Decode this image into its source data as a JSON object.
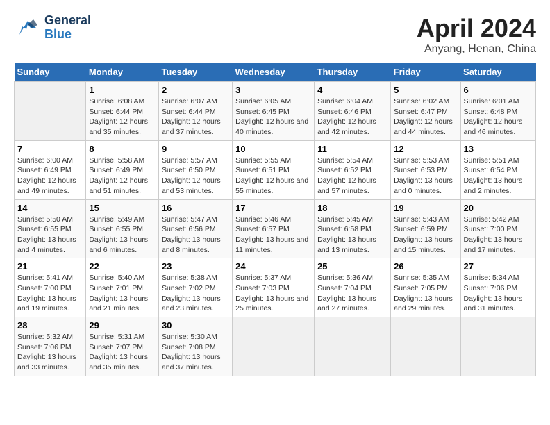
{
  "header": {
    "logo_general": "General",
    "logo_blue": "Blue",
    "title": "April 2024",
    "subtitle": "Anyang, Henan, China"
  },
  "days_of_week": [
    "Sunday",
    "Monday",
    "Tuesday",
    "Wednesday",
    "Thursday",
    "Friday",
    "Saturday"
  ],
  "weeks": [
    [
      {
        "day": "",
        "empty": true
      },
      {
        "day": "1",
        "sunrise": "Sunrise: 6:08 AM",
        "sunset": "Sunset: 6:44 PM",
        "daylight": "Daylight: 12 hours and 35 minutes."
      },
      {
        "day": "2",
        "sunrise": "Sunrise: 6:07 AM",
        "sunset": "Sunset: 6:44 PM",
        "daylight": "Daylight: 12 hours and 37 minutes."
      },
      {
        "day": "3",
        "sunrise": "Sunrise: 6:05 AM",
        "sunset": "Sunset: 6:45 PM",
        "daylight": "Daylight: 12 hours and 40 minutes."
      },
      {
        "day": "4",
        "sunrise": "Sunrise: 6:04 AM",
        "sunset": "Sunset: 6:46 PM",
        "daylight": "Daylight: 12 hours and 42 minutes."
      },
      {
        "day": "5",
        "sunrise": "Sunrise: 6:02 AM",
        "sunset": "Sunset: 6:47 PM",
        "daylight": "Daylight: 12 hours and 44 minutes."
      },
      {
        "day": "6",
        "sunrise": "Sunrise: 6:01 AM",
        "sunset": "Sunset: 6:48 PM",
        "daylight": "Daylight: 12 hours and 46 minutes."
      }
    ],
    [
      {
        "day": "7",
        "sunrise": "Sunrise: 6:00 AM",
        "sunset": "Sunset: 6:49 PM",
        "daylight": "Daylight: 12 hours and 49 minutes."
      },
      {
        "day": "8",
        "sunrise": "Sunrise: 5:58 AM",
        "sunset": "Sunset: 6:49 PM",
        "daylight": "Daylight: 12 hours and 51 minutes."
      },
      {
        "day": "9",
        "sunrise": "Sunrise: 5:57 AM",
        "sunset": "Sunset: 6:50 PM",
        "daylight": "Daylight: 12 hours and 53 minutes."
      },
      {
        "day": "10",
        "sunrise": "Sunrise: 5:55 AM",
        "sunset": "Sunset: 6:51 PM",
        "daylight": "Daylight: 12 hours and 55 minutes."
      },
      {
        "day": "11",
        "sunrise": "Sunrise: 5:54 AM",
        "sunset": "Sunset: 6:52 PM",
        "daylight": "Daylight: 12 hours and 57 minutes."
      },
      {
        "day": "12",
        "sunrise": "Sunrise: 5:53 AM",
        "sunset": "Sunset: 6:53 PM",
        "daylight": "Daylight: 13 hours and 0 minutes."
      },
      {
        "day": "13",
        "sunrise": "Sunrise: 5:51 AM",
        "sunset": "Sunset: 6:54 PM",
        "daylight": "Daylight: 13 hours and 2 minutes."
      }
    ],
    [
      {
        "day": "14",
        "sunrise": "Sunrise: 5:50 AM",
        "sunset": "Sunset: 6:55 PM",
        "daylight": "Daylight: 13 hours and 4 minutes."
      },
      {
        "day": "15",
        "sunrise": "Sunrise: 5:49 AM",
        "sunset": "Sunset: 6:55 PM",
        "daylight": "Daylight: 13 hours and 6 minutes."
      },
      {
        "day": "16",
        "sunrise": "Sunrise: 5:47 AM",
        "sunset": "Sunset: 6:56 PM",
        "daylight": "Daylight: 13 hours and 8 minutes."
      },
      {
        "day": "17",
        "sunrise": "Sunrise: 5:46 AM",
        "sunset": "Sunset: 6:57 PM",
        "daylight": "Daylight: 13 hours and 11 minutes."
      },
      {
        "day": "18",
        "sunrise": "Sunrise: 5:45 AM",
        "sunset": "Sunset: 6:58 PM",
        "daylight": "Daylight: 13 hours and 13 minutes."
      },
      {
        "day": "19",
        "sunrise": "Sunrise: 5:43 AM",
        "sunset": "Sunset: 6:59 PM",
        "daylight": "Daylight: 13 hours and 15 minutes."
      },
      {
        "day": "20",
        "sunrise": "Sunrise: 5:42 AM",
        "sunset": "Sunset: 7:00 PM",
        "daylight": "Daylight: 13 hours and 17 minutes."
      }
    ],
    [
      {
        "day": "21",
        "sunrise": "Sunrise: 5:41 AM",
        "sunset": "Sunset: 7:00 PM",
        "daylight": "Daylight: 13 hours and 19 minutes."
      },
      {
        "day": "22",
        "sunrise": "Sunrise: 5:40 AM",
        "sunset": "Sunset: 7:01 PM",
        "daylight": "Daylight: 13 hours and 21 minutes."
      },
      {
        "day": "23",
        "sunrise": "Sunrise: 5:38 AM",
        "sunset": "Sunset: 7:02 PM",
        "daylight": "Daylight: 13 hours and 23 minutes."
      },
      {
        "day": "24",
        "sunrise": "Sunrise: 5:37 AM",
        "sunset": "Sunset: 7:03 PM",
        "daylight": "Daylight: 13 hours and 25 minutes."
      },
      {
        "day": "25",
        "sunrise": "Sunrise: 5:36 AM",
        "sunset": "Sunset: 7:04 PM",
        "daylight": "Daylight: 13 hours and 27 minutes."
      },
      {
        "day": "26",
        "sunrise": "Sunrise: 5:35 AM",
        "sunset": "Sunset: 7:05 PM",
        "daylight": "Daylight: 13 hours and 29 minutes."
      },
      {
        "day": "27",
        "sunrise": "Sunrise: 5:34 AM",
        "sunset": "Sunset: 7:06 PM",
        "daylight": "Daylight: 13 hours and 31 minutes."
      }
    ],
    [
      {
        "day": "28",
        "sunrise": "Sunrise: 5:32 AM",
        "sunset": "Sunset: 7:06 PM",
        "daylight": "Daylight: 13 hours and 33 minutes."
      },
      {
        "day": "29",
        "sunrise": "Sunrise: 5:31 AM",
        "sunset": "Sunset: 7:07 PM",
        "daylight": "Daylight: 13 hours and 35 minutes."
      },
      {
        "day": "30",
        "sunrise": "Sunrise: 5:30 AM",
        "sunset": "Sunset: 7:08 PM",
        "daylight": "Daylight: 13 hours and 37 minutes."
      },
      {
        "day": "",
        "empty": true
      },
      {
        "day": "",
        "empty": true
      },
      {
        "day": "",
        "empty": true
      },
      {
        "day": "",
        "empty": true
      }
    ]
  ]
}
